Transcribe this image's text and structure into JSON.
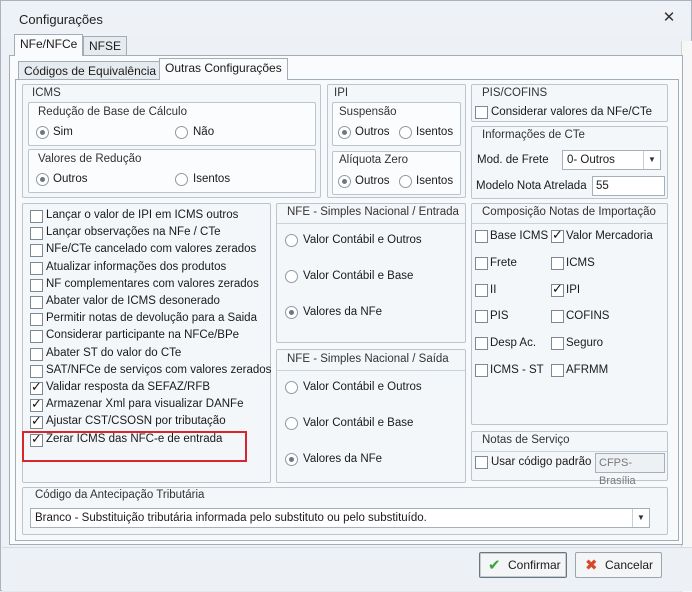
{
  "window": {
    "title": "Configurações"
  },
  "tabs": [
    "NFe/NFCe",
    "NFSE"
  ],
  "subtabs": [
    "Códigos de Equivalência",
    "Outras Configurações"
  ],
  "icms": {
    "title": "ICMS",
    "reducao_base": {
      "title": "Redução de Base de Cálculo",
      "options": [
        "Sim",
        "Não"
      ],
      "selected": "Sim"
    },
    "valores_reducao": {
      "title": "Valores de Redução",
      "options": [
        "Outros",
        "Isentos"
      ],
      "selected": "Outros"
    }
  },
  "ipi": {
    "title": "IPI",
    "suspensao": {
      "title": "Suspensão",
      "options": [
        "Outros",
        "Isentos"
      ],
      "selected": "Outros"
    },
    "aliquota_zero": {
      "title": "Alíquota Zero",
      "options": [
        "Outros",
        "Isentos"
      ],
      "selected": "Outros"
    }
  },
  "pis_cofins": {
    "title": "PIS/COFINS",
    "checkbox": {
      "label": "Considerar valores da NFe/CTe",
      "checked": false
    }
  },
  "info_cte": {
    "title": "Informações de CTe",
    "mod_frete_label": "Mod. de Frete",
    "mod_frete_value": "0- Outros",
    "modelo_label": "Modelo Nota Atrelada",
    "modelo_value": "55"
  },
  "options_list": [
    {
      "label": "Lançar o valor de IPI em ICMS outros",
      "checked": false
    },
    {
      "label": "Lançar observações na NFe / CTe",
      "checked": false
    },
    {
      "label": "NFe/CTe cancelado com valores zerados",
      "checked": false
    },
    {
      "label": "Atualizar informações dos produtos",
      "checked": false
    },
    {
      "label": "NF complementares com valores zerados",
      "checked": false
    },
    {
      "label": "Abater valor de ICMS desonerado",
      "checked": false
    },
    {
      "label": "Permitir notas de devolução para a Saida",
      "checked": false
    },
    {
      "label": "Considerar participante na NFCe/BPe",
      "checked": false
    },
    {
      "label": "Abater ST do valor do CTe",
      "checked": false
    },
    {
      "label": "SAT/NFCe de serviços com valores zerados",
      "checked": false
    },
    {
      "label": "Validar resposta da SEFAZ/RFB",
      "checked": true
    },
    {
      "label": "Armazenar Xml para visualizar DANFe",
      "checked": true
    },
    {
      "label": "Ajustar CST/CSOSN por tributação",
      "checked": true
    },
    {
      "label": "Zerar ICMS das NFC-e de entrada",
      "checked": true
    }
  ],
  "sn_entrada": {
    "title": "NFE - Simples Nacional / Entrada",
    "options": [
      "Valor Contábil e Outros",
      "Valor Contábil e Base",
      "Valores da NFe"
    ],
    "selected": "Valores da NFe"
  },
  "sn_saida": {
    "title": "NFE - Simples Nacional / Saída",
    "options": [
      "Valor Contábil e Outros",
      "Valor Contábil e Base",
      "Valores da NFe"
    ],
    "selected": "Valores da NFe"
  },
  "composicao": {
    "title": "Composição Notas de Importação",
    "items": [
      {
        "label": "Base ICMS",
        "checked": false
      },
      {
        "label": "Valor Mercadoria",
        "checked": true
      },
      {
        "label": "Frete",
        "checked": false
      },
      {
        "label": "ICMS",
        "checked": false
      },
      {
        "label": "II",
        "checked": false
      },
      {
        "label": "IPI",
        "checked": true
      },
      {
        "label": "PIS",
        "checked": false
      },
      {
        "label": "COFINS",
        "checked": false
      },
      {
        "label": "Desp Ac.",
        "checked": false
      },
      {
        "label": "Seguro",
        "checked": false
      },
      {
        "label": "ICMS - ST",
        "checked": false
      },
      {
        "label": "AFRMM",
        "checked": false
      }
    ]
  },
  "notas_servico": {
    "title": "Notas de Serviço",
    "checkbox": {
      "label": "Usar código padrão",
      "checked": false
    },
    "code_value": "CFPS-Brasília"
  },
  "antecipacao": {
    "title": "Código da Antecipação Tributária",
    "value": "Branco - Substituição tributária informada pelo substituto ou pelo substituído."
  },
  "buttons": {
    "confirm": "Confirmar",
    "cancel": "Cancelar"
  },
  "colors": {
    "highlight": "#d7262e",
    "confirm_icon": "#3aa33a",
    "cancel_icon": "#d9472b"
  }
}
